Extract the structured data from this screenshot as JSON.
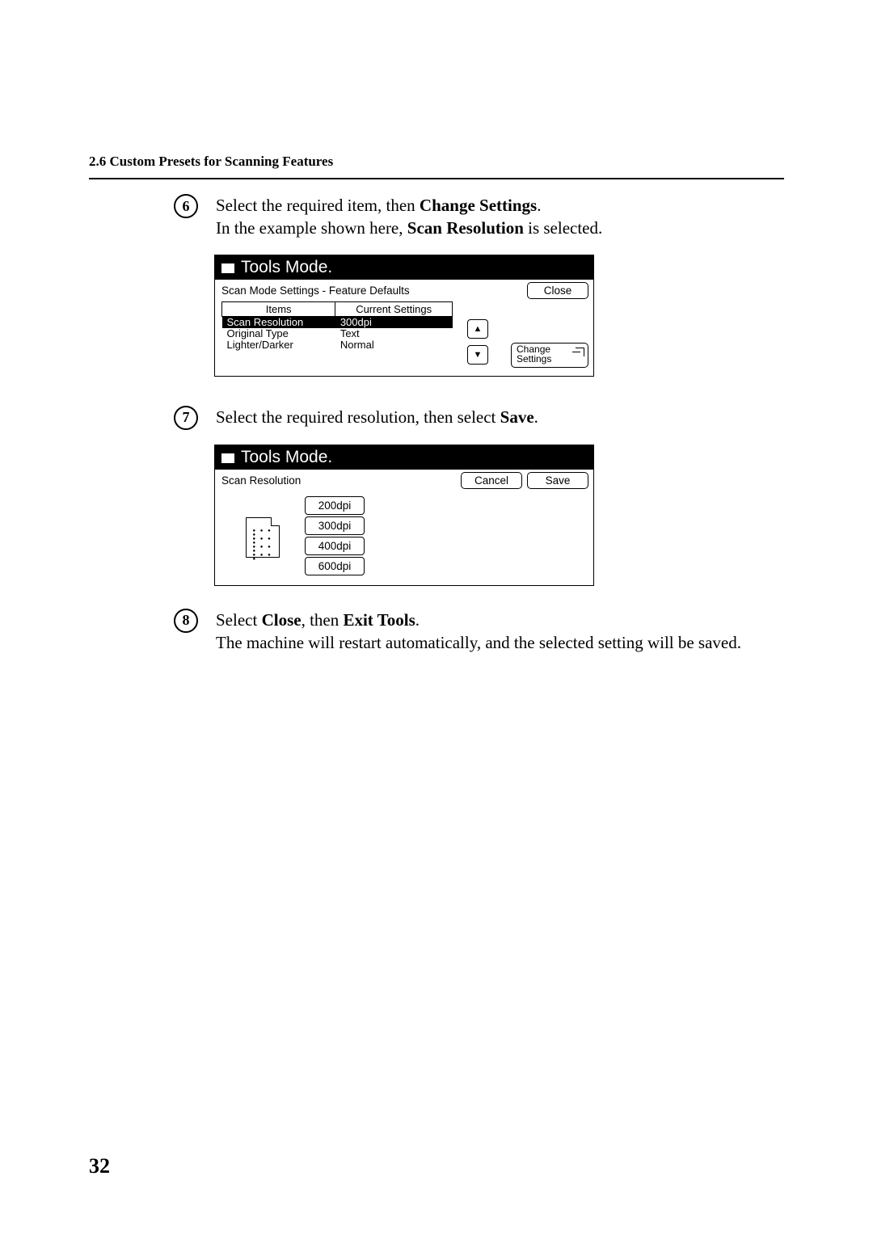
{
  "header": "2.6  Custom Presets for Scanning Features",
  "page_number": "32",
  "step6": {
    "number": "6",
    "text1a": "Select the required item, then ",
    "text1b": "Change Settings",
    "text1c": ".",
    "text2a": "In the example shown here, ",
    "text2b": "Scan Resolution",
    "text2c": " is selected."
  },
  "panel1": {
    "title": "Tools Mode.",
    "subhead": "Scan Mode Settings - Feature Defaults",
    "close_btn": "Close",
    "col_items": "Items",
    "col_current": "Current Settings",
    "rows": [
      {
        "item": "Scan Resolution",
        "value": "300dpi",
        "selected": true
      },
      {
        "item": "Original Type",
        "value": "Text",
        "selected": false
      },
      {
        "item": "Lighter/Darker",
        "value": "Normal",
        "selected": false
      }
    ],
    "change_line1": "Change",
    "change_line2": "Settings",
    "arrow_up": "▲",
    "arrow_down": "▼"
  },
  "step7": {
    "number": "7",
    "text1a": "Select the required resolution, then select ",
    "text1b": "Save",
    "text1c": "."
  },
  "panel2": {
    "title": "Tools Mode.",
    "subhead": "Scan Resolution",
    "cancel_btn": "Cancel",
    "save_btn": "Save",
    "options": [
      "200dpi",
      "300dpi",
      "400dpi",
      "600dpi"
    ]
  },
  "step8": {
    "number": "8",
    "text1a": "Select ",
    "text1b": "Close",
    "text1c": ", then ",
    "text1d": "Exit Tools",
    "text1e": ".",
    "text2": "The machine will restart automatically, and the selected setting will be saved."
  }
}
